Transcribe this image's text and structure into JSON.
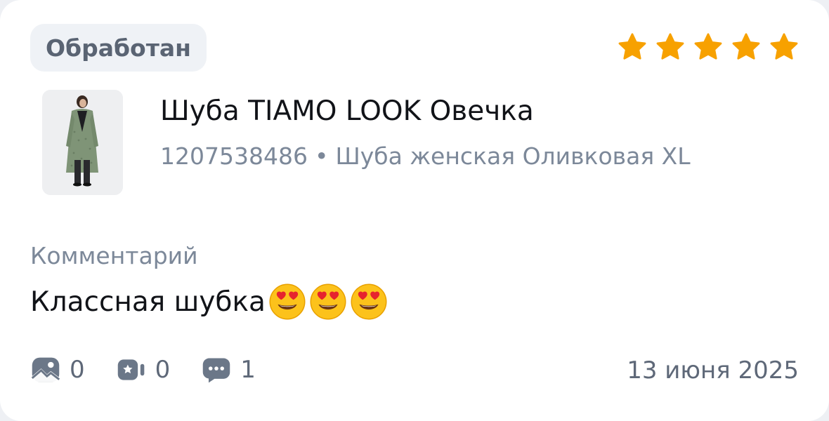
{
  "status": {
    "label": "Обработан"
  },
  "rating": {
    "value": 5,
    "max": 5,
    "color": "#f7a100"
  },
  "product": {
    "title": "Шуба TIAMO LOOK Овечка",
    "article": "1207538486",
    "separator": "•",
    "variant": "Шуба женская Оливковая XL"
  },
  "comment": {
    "label": "Комментарий",
    "text": "Классная шубка",
    "emoji": [
      "smiling-face-with-heart-eyes",
      "smiling-face-with-heart-eyes",
      "smiling-face-with-heart-eyes"
    ]
  },
  "stats": {
    "photos": {
      "icon": "photo-icon",
      "count": "0"
    },
    "videos": {
      "icon": "video-icon",
      "count": "0"
    },
    "replies": {
      "icon": "chat-icon",
      "count": "1"
    }
  },
  "date": "13 июня 2025"
}
